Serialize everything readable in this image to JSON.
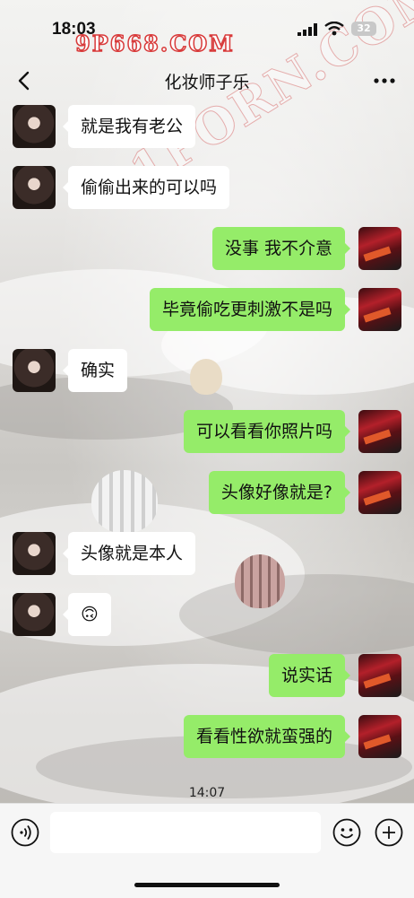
{
  "status": {
    "time": "18:03",
    "battery": "32"
  },
  "watermarks": {
    "top": "9P668.COM",
    "diagonal": "91PORN.COM"
  },
  "header": {
    "title": "化妆师子乐",
    "back_icon": "chevron-left-icon",
    "more_icon": "more-dots-icon"
  },
  "messages": [
    {
      "side": "in",
      "text": "就是我有老公"
    },
    {
      "side": "in",
      "text": "偷偷出来的可以吗"
    },
    {
      "side": "out",
      "text": "没事 我不介意"
    },
    {
      "side": "out",
      "text": "毕竟偷吃更刺激不是吗"
    },
    {
      "side": "in",
      "text": "确实"
    },
    {
      "side": "out",
      "text": "可以看看你照片吗"
    },
    {
      "side": "out",
      "text": "头像好像就是?"
    },
    {
      "side": "in",
      "text": "头像就是本人"
    },
    {
      "side": "in",
      "text": "🙃"
    },
    {
      "side": "out",
      "text": "说实话"
    },
    {
      "side": "out",
      "text": "看看性欲就蛮强的"
    }
  ],
  "timestamp": "14:07",
  "input_bar": {
    "voice_icon": "voice-icon",
    "emoji_icon": "emoji-icon",
    "plus_icon": "plus-icon",
    "placeholder": ""
  }
}
